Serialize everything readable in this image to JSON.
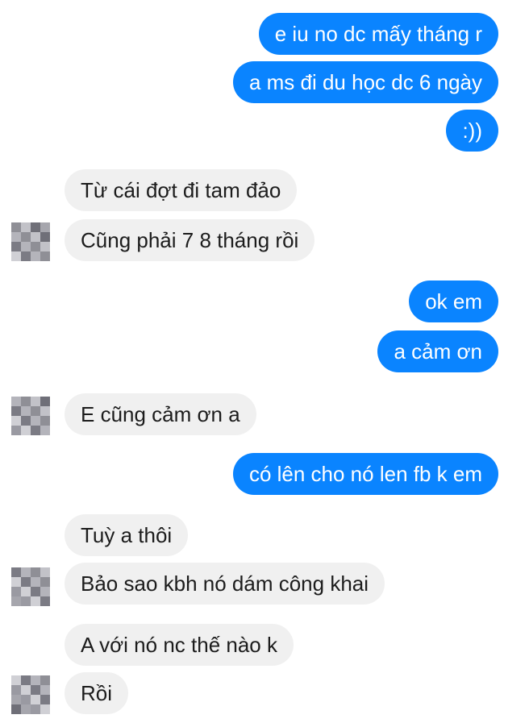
{
  "conversation": {
    "messages": [
      {
        "side": "out",
        "text": "e iu no dc mấy tháng r"
      },
      {
        "side": "out",
        "text": "a ms đi du học dc 6 ngày"
      },
      {
        "side": "out",
        "text": ":))"
      },
      {
        "side": "in",
        "text": "Từ cái đợt đi tam đảo"
      },
      {
        "side": "in",
        "text": "Cũng phải 7 8 tháng rồi"
      },
      {
        "side": "out",
        "text": "ok em"
      },
      {
        "side": "out",
        "text": "a cảm ơn"
      },
      {
        "side": "in",
        "text": "E cũng cảm ơn a"
      },
      {
        "side": "out",
        "text": "có lên cho nó len fb k em"
      },
      {
        "side": "in",
        "text": "Tuỳ a thôi"
      },
      {
        "side": "in",
        "text": "Bảo sao kbh nó dám công khai"
      },
      {
        "side": "in",
        "text": "A với nó nc thế nào k"
      },
      {
        "side": "in",
        "text": "Rồi"
      }
    ]
  },
  "colors": {
    "outgoing_bubble": "#0a84ff",
    "incoming_bubble": "#f0f0f0",
    "outgoing_text": "#ffffff",
    "incoming_text": "#1c1c1c"
  },
  "icons": {
    "avatar": "blurred-avatar-icon"
  }
}
